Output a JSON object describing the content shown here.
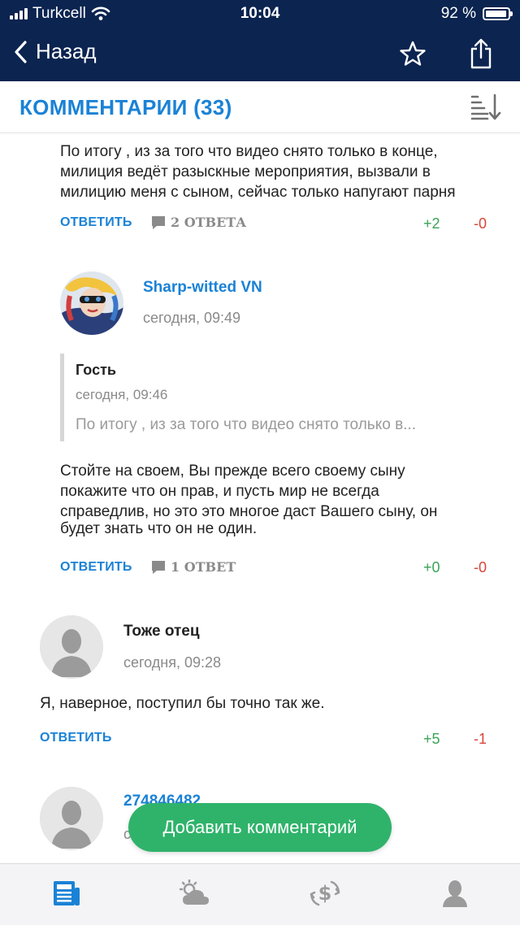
{
  "status_bar": {
    "carrier": "Turkcell",
    "time": "10:04",
    "battery": "92 %",
    "icons": [
      "signal-icon",
      "wifi-icon",
      "battery-icon"
    ]
  },
  "navbar": {
    "back_label": "Назад",
    "icons": [
      "chevron-left-icon",
      "star-icon",
      "share-icon"
    ]
  },
  "header": {
    "title": "КОММЕНТАРИИ (33)",
    "icons": [
      "sort-icon"
    ]
  },
  "comments": [
    {
      "text_lines": [
        "По итогу , из за того что видео снято только в конце,",
        "милиция ведёт разыскные мероприятия, вызвали в",
        "милицию меня с сыном, сейчас только напугают парня"
      ],
      "reply_label": "ОТВЕТИТЬ",
      "answers_label": "2 ОТВЕТА",
      "likes": "+2",
      "dislikes": "-0"
    },
    {
      "author": "Sharp-witted VN",
      "date": "сегодня, 09:49",
      "quote": {
        "author": "Гость",
        "date": "сегодня, 09:46",
        "text": "По итогу , из за того что видео снято только в..."
      },
      "text_lines": [
        "Стойте на своем, Вы прежде всего своему сыну",
        "покажите что он прав, и пусть мир не всегда",
        "справедлив, но это это многое даст Вашего сыну, он",
        "будет знать что он не один."
      ],
      "reply_label": "ОТВЕТИТЬ",
      "answers_label": "1 ОТВЕТ",
      "likes": "+0",
      "dislikes": "-0"
    },
    {
      "author": "Тоже отец",
      "date": "сегодня, 09:28",
      "text_lines": [
        "Я, наверное, поступил бы точно так же."
      ],
      "reply_label": "ОТВЕТИТЬ",
      "likes": "+5",
      "dislikes": "-1"
    },
    {
      "author": "274846482",
      "date": "с"
    }
  ],
  "add_comment_label": "Добавить комментарий",
  "tabbar": {
    "icons": [
      "news-icon",
      "weather-icon",
      "currency-icon",
      "profile-icon"
    ]
  },
  "colors": {
    "nav_bg": "#0b2450",
    "accent_blue": "#1a82d6",
    "positive_green": "#3aa356",
    "negative_red": "#d9453a",
    "fab_green": "#2fb36b"
  }
}
